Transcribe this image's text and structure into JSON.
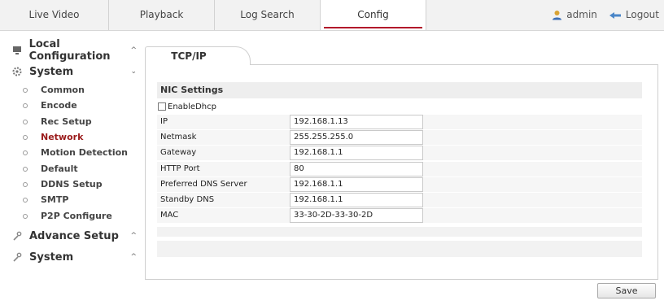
{
  "topnav": {
    "tabs": [
      {
        "label": "Live Video"
      },
      {
        "label": "Playback"
      },
      {
        "label": "Log Search"
      },
      {
        "label": "Config"
      }
    ],
    "active_tab": "Config",
    "user": "admin",
    "logout_label": "Logout"
  },
  "sidebar": {
    "local_configuration": "Local Configuration",
    "system": "System",
    "system_items": [
      {
        "label": "Common"
      },
      {
        "label": "Encode"
      },
      {
        "label": "Rec Setup"
      },
      {
        "label": "Network"
      },
      {
        "label": "Motion Detection"
      },
      {
        "label": "Default"
      },
      {
        "label": "DDNS Setup"
      },
      {
        "label": "SMTP"
      },
      {
        "label": "P2P Configure"
      }
    ],
    "active_item": "Network",
    "advance_setup": "Advance Setup",
    "system2": "System"
  },
  "main": {
    "tab_label": "TCP/IP",
    "section_title": "NIC Settings",
    "enable_dhcp_label": "EnableDhcp",
    "enable_dhcp_checked": false,
    "fields": [
      {
        "label": "IP",
        "value": "192.168.1.13"
      },
      {
        "label": "Netmask",
        "value": "255.255.255.0"
      },
      {
        "label": "Gateway",
        "value": "192.168.1.1"
      },
      {
        "label": "HTTP Port",
        "value": "80"
      },
      {
        "label": "Preferred DNS Server",
        "value": "192.168.1.1"
      },
      {
        "label": "Standby DNS",
        "value": "192.168.1.1"
      },
      {
        "label": "MAC",
        "value": "33-30-2D-33-30-2D"
      }
    ],
    "save_label": "Save"
  },
  "colors": {
    "accent": "#b2182b",
    "active_nav": "#9b1b1b"
  }
}
